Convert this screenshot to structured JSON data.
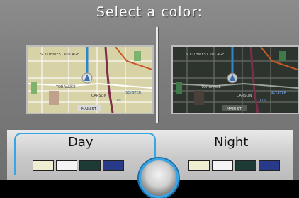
{
  "header": {
    "title": "Select a color:"
  },
  "previews": {
    "day": {
      "labels": [
        "SOUTHWEST VILLAGE",
        "TORRANCE",
        "CARSON",
        "MAIN ST",
        "SEYSTER",
        "110"
      ],
      "colors": {
        "bg": "#d7d3a6",
        "grid": "#ffffff",
        "water": "#6fb0d0",
        "park": "#7fb36d",
        "route": "#2f86c8"
      }
    },
    "night": {
      "labels": [
        "SOUTHWEST VILLAGE",
        "TORRANCE",
        "CARSON",
        "MAIN ST",
        "SEYSTER",
        "110"
      ],
      "colors": {
        "bg": "#2d332d",
        "grid": "#6f746f",
        "water": "#2f6d8a",
        "park": "#3e7a4a",
        "route": "#2f86c8"
      }
    }
  },
  "options": {
    "day": {
      "label": "Day",
      "swatches": [
        "#f0eed0",
        "#f4f4f4",
        "#1d3a37",
        "#2a3a8a"
      ]
    },
    "night": {
      "label": "Night",
      "swatches": [
        "#f0eed0",
        "#f4f4f4",
        "#1d3a37",
        "#2a3a8a"
      ]
    }
  },
  "selected": "day"
}
